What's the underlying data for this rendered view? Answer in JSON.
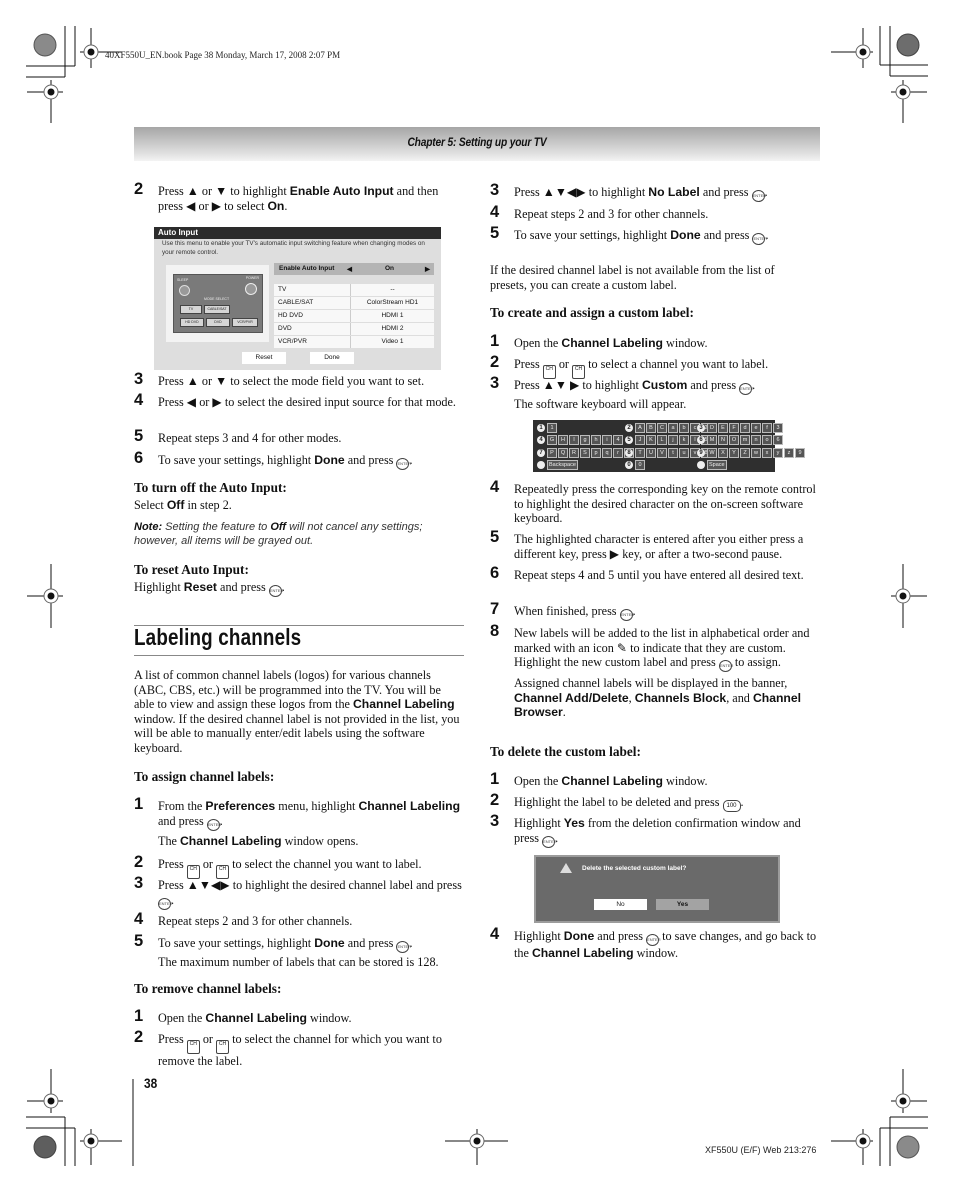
{
  "header": {
    "book_info": "40XF550U_EN.book  Page 38  Monday, March 17, 2008  2:07 PM",
    "chapter": "Chapter 5: Setting up your TV"
  },
  "left": {
    "steps_top": [
      {
        "num": "2",
        "parts": [
          "Press ▲ or ▼ to highlight ",
          "Enable Auto Input",
          " and then press ◀ or ▶ to select ",
          "On",
          "."
        ]
      },
      {
        "num": "3",
        "text": "Press ▲ or ▼ to select the mode field you want to set."
      },
      {
        "num": "4",
        "text": "Press ◀ or ▶ to select the desired input source for that mode."
      },
      {
        "num": "5",
        "text": "Repeat steps 3 and 4 for other modes."
      },
      {
        "num": "6",
        "pre": "To save your settings, highlight ",
        "bold": "Done",
        "post": " and press "
      }
    ],
    "turn_off": {
      "heading": "To turn off the Auto Input:",
      "pre": "Select ",
      "bold": "Off",
      "post": " in step 2."
    },
    "note": {
      "label": "Note:",
      "pre": " Setting the feature to ",
      "bold": "Off",
      "post": " will not cancel any settings; however, all items will be grayed out."
    },
    "reset": {
      "heading": "To reset Auto Input:",
      "pre": "Highlight ",
      "bold": "Reset",
      "post": " and press "
    },
    "section_title": "Labeling channels",
    "intro": {
      "pre": "A list of common channel labels (logos) for various channels (ABC, CBS, etc.) will be programmed into the TV. You will be able to view and assign these logos from the ",
      "bold": "Channel Labeling",
      "post": " window. If the desired channel label is not provided in the list, you will be able to manually enter/edit labels using the software keyboard."
    },
    "assign": {
      "heading": "To assign channel labels:",
      "s1": {
        "num": "1",
        "a": "From the ",
        "b": "Preferences",
        "c": " menu, highlight ",
        "d": "Channel Labeling",
        "e": " and press ",
        "f": "The ",
        "g": "Channel Labeling",
        "h": " window opens."
      },
      "s2": {
        "num": "2",
        "a": "Press ",
        "b": " or ",
        "c": " to select the channel you want to label."
      },
      "s3": {
        "num": "3",
        "a": "Press ▲▼◀▶ to highlight the desired channel label and press ",
        "b": "."
      },
      "s4": {
        "num": "4",
        "text": "Repeat steps 2 and 3 for other channels."
      },
      "s5": {
        "num": "5",
        "a": "To save your settings, highlight ",
        "b": "Done",
        "c": " and press ",
        "d": "The maximum number of labels that can be stored is 128."
      }
    },
    "remove": {
      "heading": "To remove channel labels:",
      "s1": {
        "num": "1",
        "a": "Open the ",
        "b": "Channel Labeling",
        "c": " window."
      },
      "s2": {
        "num": "2",
        "a": "Press ",
        "b": " or ",
        "c": " to select the channel for which you want to remove the label."
      }
    }
  },
  "auto_input_screen": {
    "title": "Auto Input",
    "description": "Use this menu to enable your TV's automatic input switching feature when changing modes on your remote control.",
    "enable_label": "Enable Auto Input",
    "enable_value": "On",
    "remote": {
      "sleep": "SLEEP",
      "power": "POWER",
      "mode_select": "MODE SELECT",
      "buttons": [
        "TV",
        "CABLE/SAT",
        "HD DVD",
        "DVD",
        "VCR/PVR"
      ]
    },
    "rows": [
      {
        "mode": "TV",
        "input": "--"
      },
      {
        "mode": "CABLE/SAT",
        "input": "ColorStream HD1"
      },
      {
        "mode": "HD DVD",
        "input": "HDMI 1"
      },
      {
        "mode": "DVD",
        "input": "HDMI 2"
      },
      {
        "mode": "VCR/PVR",
        "input": "Video 1"
      }
    ],
    "reset_button": "Reset",
    "done_button": "Done"
  },
  "right": {
    "steps_top": [
      {
        "num": "3",
        "a": "Press ▲▼◀▶ to highlight ",
        "b": "No Label",
        "c": " and press "
      },
      {
        "num": "4",
        "text": "Repeat steps 2 and 3 for other channels."
      },
      {
        "num": "5",
        "a": "To save your settings, highlight ",
        "b": "Done",
        "c": " and press "
      }
    ],
    "custom_intro": "If the desired channel label is not available from the list of presets, you can create a custom label.",
    "create": {
      "heading": "To create and assign a custom label:",
      "s1": {
        "num": "1",
        "a": "Open the ",
        "b": "Channel Labeling",
        "c": " window."
      },
      "s2": {
        "num": "2",
        "a": "Press ",
        "b": " or ",
        "c": " to select a channel you want to label."
      },
      "s3": {
        "num": "3",
        "a": "Press ▲▼ ▶ to highlight ",
        "b": "Custom",
        "c": " and press ",
        "d": "The software keyboard will appear."
      },
      "s4": {
        "num": "4",
        "text": "Repeatedly press the corresponding key on the remote control to highlight the desired character on the on-screen software keyboard."
      },
      "s5": {
        "num": "5",
        "text": "The highlighted character is entered after you either press a different key, press ▶ key, or after a two-second pause."
      },
      "s6": {
        "num": "6",
        "text": "Repeat steps 4 and 5 until you have entered all desired text."
      },
      "s7": {
        "num": "7",
        "text": "When finished, press "
      },
      "s8": {
        "num": "8",
        "a": "New labels will be added to the list in alphabetical order and marked with an icon ",
        "b": " to indicate that they are custom. Highlight the new custom label and press ",
        "c": " to assign.",
        "d": "Assigned channel labels will be displayed in the banner, ",
        "e": "Channel Add/Delete",
        "f": ", ",
        "g": "Channels Block",
        "h": ", and ",
        "i": "Channel Browser",
        "j": "."
      }
    },
    "delete": {
      "heading": "To delete the custom label:",
      "s1": {
        "num": "1",
        "a": "Open the ",
        "b": "Channel Labeling",
        "c": " window."
      },
      "s2": {
        "num": "2",
        "a": "Highlight the label to be deleted and press ",
        "b": "."
      },
      "s3": {
        "num": "3",
        "a": "Highlight ",
        "b": "Yes",
        "c": " from the deletion confirmation window and press ",
        "d": "."
      },
      "s4": {
        "num": "4",
        "a": "Highlight ",
        "b": "Done",
        "c": " and press ",
        "d": " to save changes, and go back to the ",
        "e": "Channel Labeling",
        "f": " window."
      }
    }
  },
  "keyboard": {
    "rows": [
      [
        {
          "n": "1",
          "keys": [
            "1"
          ]
        },
        {
          "n": "2",
          "keys": [
            "A",
            "B",
            "C",
            "a",
            "b",
            "c",
            "2"
          ]
        },
        {
          "n": "3",
          "keys": [
            "D",
            "E",
            "F",
            "d",
            "e",
            "f",
            "3"
          ]
        }
      ],
      [
        {
          "n": "4",
          "keys": [
            "G",
            "H",
            "I",
            "g",
            "h",
            "i",
            "4"
          ]
        },
        {
          "n": "5",
          "keys": [
            "J",
            "K",
            "L",
            "j",
            "k",
            "l",
            "5"
          ]
        },
        {
          "n": "6",
          "keys": [
            "M",
            "N",
            "O",
            "m",
            "n",
            "o",
            "6"
          ]
        }
      ],
      [
        {
          "n": "7",
          "keys": [
            "P",
            "Q",
            "R",
            "S",
            "p",
            "q",
            "r",
            "s",
            "7"
          ]
        },
        {
          "n": "8",
          "keys": [
            "T",
            "U",
            "V",
            "t",
            "u",
            "v",
            "8"
          ]
        },
        {
          "n": "9",
          "keys": [
            "W",
            "X",
            "Y",
            "Z",
            "w",
            "x",
            "y",
            "z",
            "9"
          ]
        }
      ],
      [
        {
          "n": "100",
          "keys": [
            "Backspace"
          ]
        },
        {
          "n": "0",
          "keys": [
            "0"
          ]
        },
        {
          "n": "ENT",
          "keys": [
            "Space"
          ]
        }
      ]
    ]
  },
  "delete_dialog": {
    "message": "Delete the selected custom label?",
    "no": "No",
    "yes": "Yes"
  },
  "icons": {
    "enter": "ENTER",
    "ch_up": "CH",
    "ch_down": "CH",
    "hundred": "100",
    "pencil": "✎"
  },
  "footer": {
    "page_number": "38",
    "code": "XF550U (E/F) Web 213:276"
  }
}
